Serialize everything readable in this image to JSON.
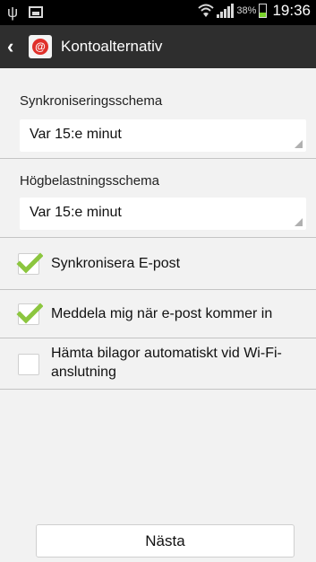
{
  "status_bar": {
    "battery_percent": "38%",
    "time": "19:36",
    "battery_level": 0.38
  },
  "action_bar": {
    "title": "Kontoalternativ"
  },
  "sync_schedule": {
    "label": "Synkroniseringsschema",
    "value": "Var 15:e minut"
  },
  "peak_schedule": {
    "label": "Högbelastningsschema",
    "value": "Var 15:e minut"
  },
  "checkboxes": [
    {
      "label": "Synkronisera E-post",
      "checked": true
    },
    {
      "label": "Meddela mig när e-post kommer in",
      "checked": true
    },
    {
      "label": "Hämta bilagor automatiskt vid Wi-Fi-anslutning",
      "checked": false
    }
  ],
  "next_button": {
    "label": "Nästa"
  },
  "colors": {
    "check_green": "#8cc63f",
    "action_bar": "#2e2e2e",
    "background": "#f2f2f2"
  }
}
